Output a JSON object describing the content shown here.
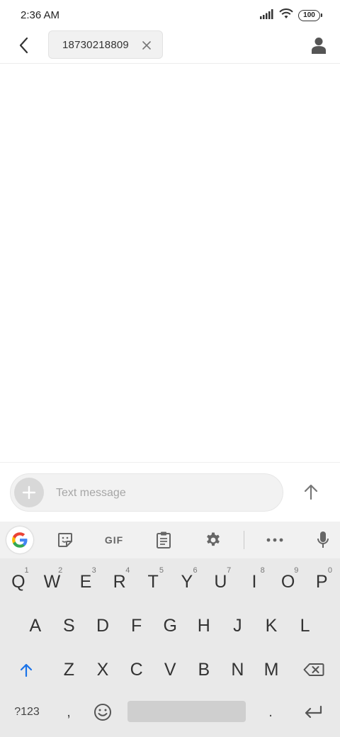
{
  "status_bar": {
    "time": "2:36 AM",
    "battery": "100"
  },
  "header": {
    "recipient": "18730218809"
  },
  "composer": {
    "placeholder": "Text message",
    "value": ""
  },
  "keyboard": {
    "toolbar": {
      "gif_label": "GIF"
    },
    "row1": [
      {
        "label": "Q",
        "hint": "1"
      },
      {
        "label": "W",
        "hint": "2"
      },
      {
        "label": "E",
        "hint": "3"
      },
      {
        "label": "R",
        "hint": "4"
      },
      {
        "label": "T",
        "hint": "5"
      },
      {
        "label": "Y",
        "hint": "6"
      },
      {
        "label": "U",
        "hint": "7"
      },
      {
        "label": "I",
        "hint": "8"
      },
      {
        "label": "O",
        "hint": "9"
      },
      {
        "label": "P",
        "hint": "0"
      }
    ],
    "row2": [
      "A",
      "S",
      "D",
      "F",
      "G",
      "H",
      "J",
      "K",
      "L"
    ],
    "row3": [
      "Z",
      "X",
      "C",
      "V",
      "B",
      "N",
      "M"
    ],
    "row4": {
      "symbols_label": "?123",
      "comma_label": ",",
      "period_label": "."
    }
  },
  "colors": {
    "accent": "#1a73e8",
    "keyboard_bg": "#e9e9e9",
    "toolbar_bg": "#f1f1f1"
  }
}
